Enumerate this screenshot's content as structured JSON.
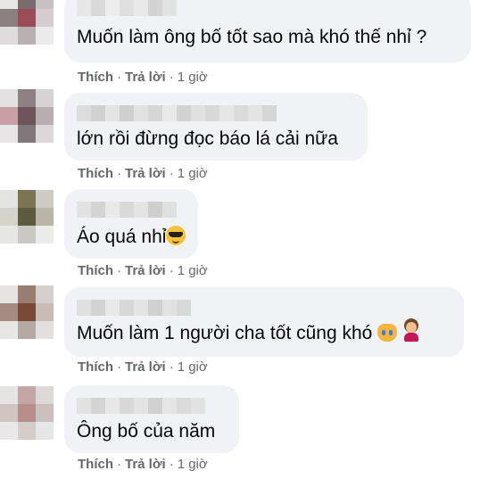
{
  "comments": [
    {
      "text": "Muốn làm ông bố tốt sao mà khó thế nhỉ ?",
      "emojis": [],
      "actions": {
        "like": "Thích",
        "reply": "Trả lời",
        "sep": "·",
        "time": "1 giờ"
      }
    },
    {
      "text": "lớn rồi đừng đọc báo lá cải nữa",
      "emojis": [],
      "actions": {
        "like": "Thích",
        "reply": "Trả lời",
        "sep": "·",
        "time": "1 giờ"
      }
    },
    {
      "text": "Áo quá nhỉ",
      "emojis": [
        "smiling-face-with-sunglasses-icon"
      ],
      "actions": {
        "like": "Thích",
        "reply": "Trả lời",
        "sep": "·",
        "time": "1 giờ"
      }
    },
    {
      "text": "Muốn làm 1 người cha tốt cũng khó",
      "emojis": [
        "crying-cat-icon",
        "person-facepalming-icon"
      ],
      "actions": {
        "like": "Thích",
        "reply": "Trả lời",
        "sep": "·",
        "time": "1 giờ"
      }
    },
    {
      "text": "Ông bố của năm",
      "emojis": [],
      "actions": {
        "like": "Thích",
        "reply": "Trả lời",
        "sep": "·",
        "time": "1 giờ"
      }
    }
  ],
  "colors": {
    "bubble_bg": "#f0f2f5",
    "text": "#050505",
    "secondary": "#65676b"
  }
}
